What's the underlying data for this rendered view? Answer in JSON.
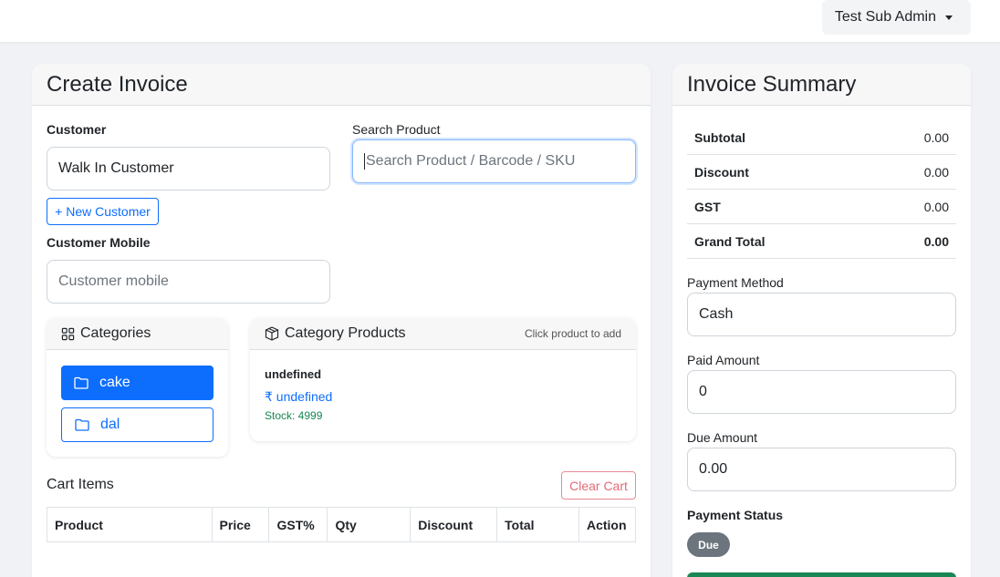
{
  "topbar": {
    "user_name": "Test Sub Admin"
  },
  "invoice": {
    "title": "Create Invoice",
    "customer_label": "Customer",
    "customer_value": "Walk In Customer",
    "new_customer_label": "+ New Customer",
    "mobile_label": "Customer Mobile",
    "mobile_placeholder": "Customer mobile",
    "search_label": "Search Product",
    "search_placeholder": "Search Product / Barcode / SKU"
  },
  "categories": {
    "title": "Categories",
    "items": [
      {
        "label": "cake",
        "active": true
      },
      {
        "label": "dal",
        "active": false
      }
    ]
  },
  "category_products": {
    "title": "Category Products",
    "hint": "Click product to add",
    "items": [
      {
        "name": "undefined",
        "price": "₹ undefined",
        "stock": "Stock: 4999"
      }
    ]
  },
  "cart": {
    "title": "Cart Items",
    "clear_label": "Clear Cart",
    "columns": [
      "Product",
      "Price",
      "GST%",
      "Qty",
      "Discount",
      "Total",
      "Action"
    ]
  },
  "summary": {
    "title": "Invoice Summary",
    "rows": [
      {
        "label": "Subtotal",
        "value": "0.00"
      },
      {
        "label": "Discount",
        "value": "0.00"
      },
      {
        "label": "GST",
        "value": "0.00"
      },
      {
        "label": "Grand Total",
        "value": "0.00"
      }
    ],
    "payment_method_label": "Payment Method",
    "payment_method_value": "Cash",
    "paid_amount_label": "Paid Amount",
    "paid_amount_value": "0",
    "due_amount_label": "Due Amount",
    "due_amount_value": "0.00",
    "payment_status_label": "Payment Status",
    "payment_status_value": "Due"
  },
  "colors": {
    "primary": "#0d6efd",
    "danger": "#dc3545",
    "success": "#198754",
    "secondary": "#6c757d",
    "background": "#f0f2f5"
  },
  "icons": {
    "categories": "grid-icon",
    "category_products": "box-icon",
    "category_item": "folder-icon",
    "user_menu": "caret-down-icon"
  }
}
